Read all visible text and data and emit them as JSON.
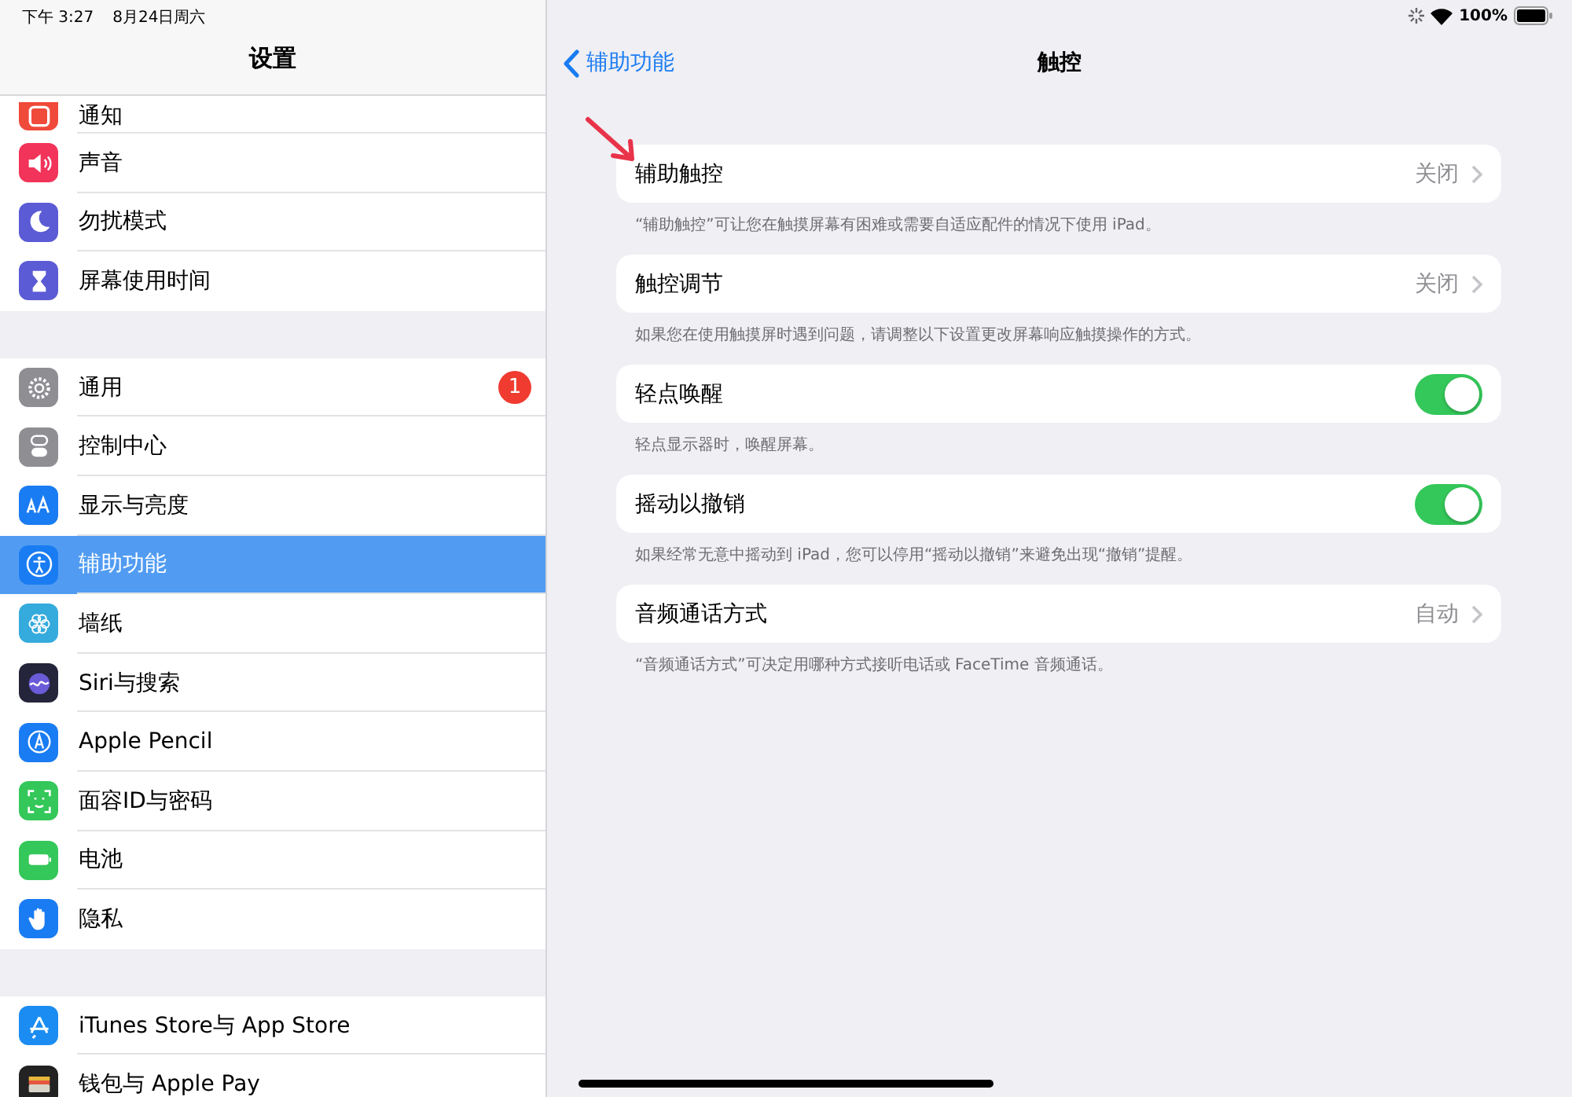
{
  "status_bar": {
    "time": "下午 3:27",
    "date": "8月24日周六",
    "battery": "100%"
  },
  "sidebar": {
    "title": "设置",
    "groups": [
      [
        {
          "label": "通知",
          "kind": "notification",
          "color": "#f04a3a",
          "selected": false
        },
        {
          "label": "声音",
          "kind": "speaker",
          "color": "#f2345a",
          "selected": false
        },
        {
          "label": "勿扰模式",
          "kind": "moon",
          "color": "#5b5bd6",
          "selected": false
        },
        {
          "label": "屏幕使用时间",
          "kind": "hourglass",
          "color": "#5b5bd6",
          "selected": false
        }
      ],
      [
        {
          "label": "通用",
          "kind": "gear",
          "color": "#8e8e93",
          "selected": false,
          "badge": "1"
        },
        {
          "label": "控制中心",
          "kind": "toggles",
          "color": "#8e8e93",
          "selected": false
        },
        {
          "label": "显示与亮度",
          "kind": "text-size",
          "color": "#1a7cf2",
          "selected": false
        },
        {
          "label": "辅助功能",
          "kind": "accessibility",
          "color": "#1a7cf2",
          "selected": true
        },
        {
          "label": "墙纸",
          "kind": "flower",
          "color": "#35aadc",
          "selected": false
        },
        {
          "label": "Siri与搜索",
          "kind": "siri",
          "color": "#24243a",
          "selected": false
        },
        {
          "label": "Apple Pencil",
          "kind": "pencil",
          "color": "#1a7cf2",
          "selected": false
        },
        {
          "label": "面容ID与密码",
          "kind": "face",
          "color": "#34c759",
          "selected": false
        },
        {
          "label": "电池",
          "kind": "battery",
          "color": "#34c759",
          "selected": false
        },
        {
          "label": "隐私",
          "kind": "hand",
          "color": "#1a7cf2",
          "selected": false
        }
      ],
      [
        {
          "label": "iTunes Store与 App Store",
          "kind": "app-store",
          "color": "#1a8cf2",
          "selected": false
        },
        {
          "label": "钱包与 Apple Pay",
          "kind": "wallet",
          "color": "#222222",
          "selected": false
        }
      ]
    ]
  },
  "detail": {
    "back": "辅助功能",
    "title": "触控",
    "rows": [
      {
        "kind": "link",
        "label": "辅助触控",
        "value": "关闭",
        "footer": "“辅助触控”可让您在触摸屏幕有困难或需要自适应配件的情况下使用 iPad。"
      },
      {
        "kind": "link",
        "label": "触控调节",
        "value": "关闭",
        "footer": "如果您在使用触摸屏时遇到问题，请调整以下设置更改屏幕响应触摸操作的方式。"
      },
      {
        "kind": "toggle",
        "label": "轻点唤醒",
        "on": true,
        "footer": "轻点显示器时，唤醒屏幕。"
      },
      {
        "kind": "toggle",
        "label": "摇动以撤销",
        "on": true,
        "footer": "如果经常无意中摇动到 iPad，您可以停用“摇动以撤销”来避免出现“撤销”提醒。"
      },
      {
        "kind": "link",
        "label": "音频通话方式",
        "value": "自动",
        "footer": "“音频通话方式”可决定用哪种方式接听电话或 FaceTime 音频通话。"
      }
    ]
  }
}
